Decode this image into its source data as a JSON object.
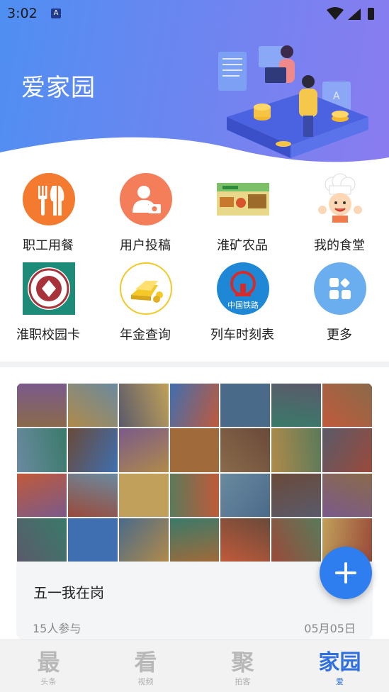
{
  "status_bar": {
    "time": "3:02",
    "notification_badge": "A"
  },
  "header": {
    "title": "爱家园"
  },
  "shortcuts": [
    {
      "label": "职工用餐",
      "icon": "fork-knife-icon",
      "color": "#f37a2e"
    },
    {
      "label": "用户投稿",
      "icon": "user-camera-icon",
      "color": "#f47e5a"
    },
    {
      "label": "淮矿农品",
      "icon": "farm-products-icon"
    },
    {
      "label": "我的食堂",
      "icon": "chef-icon"
    },
    {
      "label": "淮职校园卡",
      "icon": "campus-card-icon",
      "color": "#1d8b78"
    },
    {
      "label": "年金查询",
      "icon": "gold-bars-icon",
      "color": "#f3c928"
    },
    {
      "label": "列车时刻表",
      "icon": "china-railway-icon",
      "color": "#1e88d6",
      "badge_text": "中国铁路"
    },
    {
      "label": "更多",
      "icon": "grid-more-icon",
      "color": "#6aaef0"
    }
  ],
  "card": {
    "title": "五一我在岗",
    "participants": "15人参与",
    "date": "05月05日"
  },
  "fab": {
    "icon": "plus-icon"
  },
  "bottom_nav": [
    {
      "glyph": "最",
      "sub": "头条",
      "active": false
    },
    {
      "glyph": "看",
      "sub": "视频",
      "active": false
    },
    {
      "glyph": "聚",
      "sub": "拍客",
      "active": false
    },
    {
      "glyph": "家园",
      "sub": "爱",
      "active": true
    }
  ],
  "colors": {
    "accent": "#2e7ef0",
    "header_start": "#4f8ff2",
    "header_end": "#8a7cf0"
  }
}
